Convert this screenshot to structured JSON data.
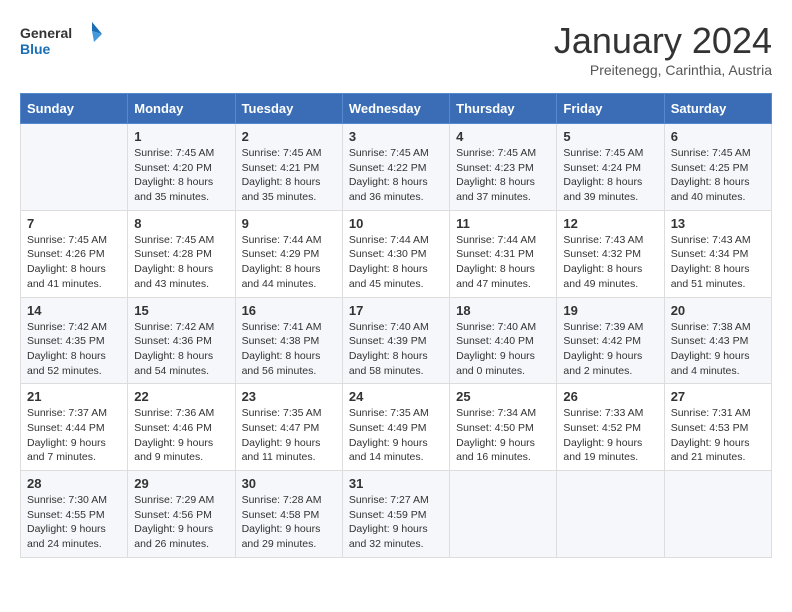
{
  "header": {
    "logo_line1": "General",
    "logo_line2": "Blue",
    "month_title": "January 2024",
    "location": "Preitenegg, Carinthia, Austria"
  },
  "days_of_week": [
    "Sunday",
    "Monday",
    "Tuesday",
    "Wednesday",
    "Thursday",
    "Friday",
    "Saturday"
  ],
  "weeks": [
    [
      {
        "day": "",
        "sunrise": "",
        "sunset": "",
        "daylight": ""
      },
      {
        "day": "1",
        "sunrise": "7:45 AM",
        "sunset": "4:20 PM",
        "daylight": "8 hours and 35 minutes."
      },
      {
        "day": "2",
        "sunrise": "7:45 AM",
        "sunset": "4:21 PM",
        "daylight": "8 hours and 35 minutes."
      },
      {
        "day": "3",
        "sunrise": "7:45 AM",
        "sunset": "4:22 PM",
        "daylight": "8 hours and 36 minutes."
      },
      {
        "day": "4",
        "sunrise": "7:45 AM",
        "sunset": "4:23 PM",
        "daylight": "8 hours and 37 minutes."
      },
      {
        "day": "5",
        "sunrise": "7:45 AM",
        "sunset": "4:24 PM",
        "daylight": "8 hours and 39 minutes."
      },
      {
        "day": "6",
        "sunrise": "7:45 AM",
        "sunset": "4:25 PM",
        "daylight": "8 hours and 40 minutes."
      }
    ],
    [
      {
        "day": "7",
        "sunrise": "7:45 AM",
        "sunset": "4:26 PM",
        "daylight": "8 hours and 41 minutes."
      },
      {
        "day": "8",
        "sunrise": "7:45 AM",
        "sunset": "4:28 PM",
        "daylight": "8 hours and 43 minutes."
      },
      {
        "day": "9",
        "sunrise": "7:44 AM",
        "sunset": "4:29 PM",
        "daylight": "8 hours and 44 minutes."
      },
      {
        "day": "10",
        "sunrise": "7:44 AM",
        "sunset": "4:30 PM",
        "daylight": "8 hours and 45 minutes."
      },
      {
        "day": "11",
        "sunrise": "7:44 AM",
        "sunset": "4:31 PM",
        "daylight": "8 hours and 47 minutes."
      },
      {
        "day": "12",
        "sunrise": "7:43 AM",
        "sunset": "4:32 PM",
        "daylight": "8 hours and 49 minutes."
      },
      {
        "day": "13",
        "sunrise": "7:43 AM",
        "sunset": "4:34 PM",
        "daylight": "8 hours and 51 minutes."
      }
    ],
    [
      {
        "day": "14",
        "sunrise": "7:42 AM",
        "sunset": "4:35 PM",
        "daylight": "8 hours and 52 minutes."
      },
      {
        "day": "15",
        "sunrise": "7:42 AM",
        "sunset": "4:36 PM",
        "daylight": "8 hours and 54 minutes."
      },
      {
        "day": "16",
        "sunrise": "7:41 AM",
        "sunset": "4:38 PM",
        "daylight": "8 hours and 56 minutes."
      },
      {
        "day": "17",
        "sunrise": "7:40 AM",
        "sunset": "4:39 PM",
        "daylight": "8 hours and 58 minutes."
      },
      {
        "day": "18",
        "sunrise": "7:40 AM",
        "sunset": "4:40 PM",
        "daylight": "9 hours and 0 minutes."
      },
      {
        "day": "19",
        "sunrise": "7:39 AM",
        "sunset": "4:42 PM",
        "daylight": "9 hours and 2 minutes."
      },
      {
        "day": "20",
        "sunrise": "7:38 AM",
        "sunset": "4:43 PM",
        "daylight": "9 hours and 4 minutes."
      }
    ],
    [
      {
        "day": "21",
        "sunrise": "7:37 AM",
        "sunset": "4:44 PM",
        "daylight": "9 hours and 7 minutes."
      },
      {
        "day": "22",
        "sunrise": "7:36 AM",
        "sunset": "4:46 PM",
        "daylight": "9 hours and 9 minutes."
      },
      {
        "day": "23",
        "sunrise": "7:35 AM",
        "sunset": "4:47 PM",
        "daylight": "9 hours and 11 minutes."
      },
      {
        "day": "24",
        "sunrise": "7:35 AM",
        "sunset": "4:49 PM",
        "daylight": "9 hours and 14 minutes."
      },
      {
        "day": "25",
        "sunrise": "7:34 AM",
        "sunset": "4:50 PM",
        "daylight": "9 hours and 16 minutes."
      },
      {
        "day": "26",
        "sunrise": "7:33 AM",
        "sunset": "4:52 PM",
        "daylight": "9 hours and 19 minutes."
      },
      {
        "day": "27",
        "sunrise": "7:31 AM",
        "sunset": "4:53 PM",
        "daylight": "9 hours and 21 minutes."
      }
    ],
    [
      {
        "day": "28",
        "sunrise": "7:30 AM",
        "sunset": "4:55 PM",
        "daylight": "9 hours and 24 minutes."
      },
      {
        "day": "29",
        "sunrise": "7:29 AM",
        "sunset": "4:56 PM",
        "daylight": "9 hours and 26 minutes."
      },
      {
        "day": "30",
        "sunrise": "7:28 AM",
        "sunset": "4:58 PM",
        "daylight": "9 hours and 29 minutes."
      },
      {
        "day": "31",
        "sunrise": "7:27 AM",
        "sunset": "4:59 PM",
        "daylight": "9 hours and 32 minutes."
      },
      {
        "day": "",
        "sunrise": "",
        "sunset": "",
        "daylight": ""
      },
      {
        "day": "",
        "sunrise": "",
        "sunset": "",
        "daylight": ""
      },
      {
        "day": "",
        "sunrise": "",
        "sunset": "",
        "daylight": ""
      }
    ]
  ]
}
